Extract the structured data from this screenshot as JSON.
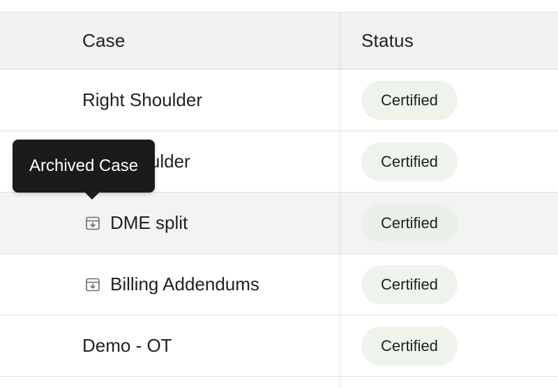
{
  "table": {
    "headers": {
      "case": "Case",
      "status": "Status"
    },
    "rows": [
      {
        "case": "Right Shoulder",
        "archived": false,
        "status": "Certified"
      },
      {
        "case": "Left Shoulder",
        "archived": false,
        "status": "Certified"
      },
      {
        "case": "DME split",
        "archived": true,
        "status": "Certified"
      },
      {
        "case": "Billing Addendums",
        "archived": true,
        "status": "Certified"
      },
      {
        "case": "Demo - OT",
        "archived": false,
        "status": "Certified"
      }
    ]
  },
  "tooltip": {
    "text": "Archived Case"
  },
  "icons": {
    "archived": "archive-box-icon"
  },
  "colors": {
    "badge_bg": "#eef4ec",
    "header_bg": "#f2f2f2",
    "tooltip_bg": "#1b1b1b"
  }
}
